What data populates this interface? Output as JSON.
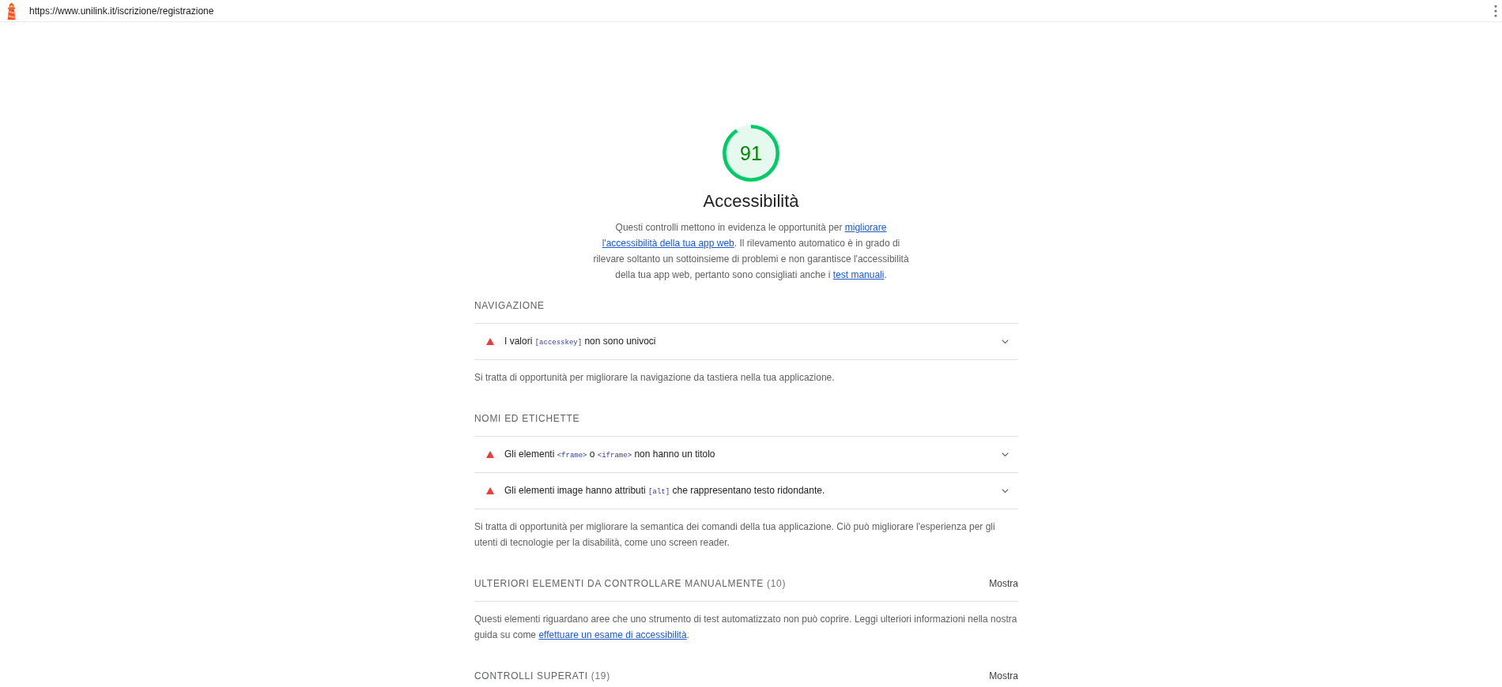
{
  "top_bar": {
    "url": "https://www.unilink.it/iscrizione/registrazione"
  },
  "category": {
    "score": "91",
    "level": 0.91,
    "kind": "pass",
    "title": "Accessibilità",
    "description": [
      {
        "kind": "text",
        "text": "Questi controlli mettono in evidenza le opportunità per "
      },
      {
        "kind": "link",
        "text": "migliorare"
      },
      {
        "kind": "link",
        "text": "l'accessibilità della tua app web"
      },
      {
        "kind": "text",
        "text": ". Il rilevamento automatico è in grado di rilevare soltanto un sottoinsieme di problemi e non garantisce l'accessibilità della tua app web, pertanto sono consigliati anche i "
      },
      {
        "kind": "link",
        "text": "test manuali"
      },
      {
        "kind": "text",
        "text": "."
      }
    ]
  },
  "groups": [
    {
      "title": "NAVIGAZIONE",
      "audits": [
        {
          "kind": "fail",
          "expanded": false,
          "title": [
            {
              "kind": "text",
              "text": "I valori "
            },
            {
              "kind": "code",
              "text": "[accesskey]"
            },
            {
              "kind": "text",
              "text": " non sono univoci"
            }
          ]
        }
      ],
      "description": [
        {
          "kind": "text",
          "text": "Si tratta di opportunità per migliorare la navigazione da tastiera nella tua applicazione."
        }
      ]
    },
    {
      "title": "NOMI ED ETICHETTE",
      "audits": [
        {
          "kind": "fail",
          "expanded": false,
          "title": [
            {
              "kind": "text",
              "text": "Gli elementi "
            },
            {
              "kind": "code",
              "text": "<frame>"
            },
            {
              "kind": "text",
              "text": " o "
            },
            {
              "kind": "code",
              "text": "<iframe>"
            },
            {
              "kind": "text",
              "text": " non hanno un titolo"
            }
          ]
        },
        {
          "kind": "fail",
          "expanded": false,
          "title": [
            {
              "kind": "text",
              "text": "Gli elementi image hanno attributi "
            },
            {
              "kind": "code",
              "text": "[alt]"
            },
            {
              "kind": "text",
              "text": " che rappresentano testo ridondante."
            }
          ]
        }
      ],
      "description": [
        {
          "kind": "text",
          "text": "Si tratta di opportunità per migliorare la semantica dei comandi della tua applicazione. Ciò può migliorare l'esperienza per gli utenti di tecnologie per la disabilità, come uno screen reader."
        }
      ]
    },
    {
      "title": "ULTERIORI ELEMENTI DA CONTROLLARE MANUALMENTE",
      "count": "(10)",
      "toggle": "Mostra",
      "description": [
        {
          "kind": "text",
          "text": "Questi elementi riguardano aree che uno strumento di test automatizzato non può coprire. Leggi ulteriori informazioni nella nostra guida su come "
        },
        {
          "kind": "link",
          "text": "effettuare un esame di accessibilità"
        },
        {
          "kind": "text",
          "text": "."
        }
      ]
    },
    {
      "title": "CONTROLLI SUPERATI",
      "count": "(19)",
      "toggle": "Mostra"
    }
  ]
}
